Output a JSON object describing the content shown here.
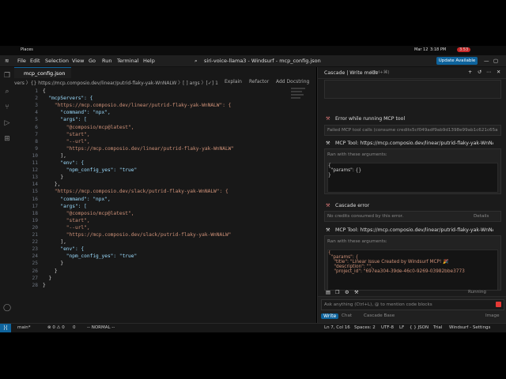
{
  "os": {
    "places": "Places",
    "date": "Mar 12",
    "time": "3:18 PM",
    "battery_badge": "3.53"
  },
  "menu": {
    "items": [
      "File",
      "Edit",
      "Selection",
      "View",
      "Go",
      "Run",
      "Terminal",
      "Help"
    ],
    "search": "siri-voice-llama3 - Windsurf - mcp_config.json",
    "update": "Update Available"
  },
  "editor": {
    "tab": "mcp_config.json",
    "breadcrumb": "vers 〉{} https://mcp.composio.dev/linear/putrid-flaky-yak-WnNALW 〉[ ] args 〉[✓] 1",
    "codelens": [
      "Explain",
      "Refactor",
      "Add Docstring"
    ],
    "lines": [
      {
        "n": "1",
        "t": "{"
      },
      {
        "n": "2",
        "t": "  \"mcpServers\": {"
      },
      {
        "n": "3",
        "t": "    \"https://mcp.composio.dev/linear/putrid-flaky-yak-WnNALW\": {"
      },
      {
        "n": "4",
        "t": "      \"command\": \"npx\","
      },
      {
        "n": "5",
        "t": "      \"args\": ["
      },
      {
        "n": "6",
        "t": "        \"@composio/mcp@latest\","
      },
      {
        "n": "7",
        "t": "        \"start\","
      },
      {
        "n": "8",
        "t": "        \"--url\","
      },
      {
        "n": "9",
        "t": "        \"https://mcp.composio.dev/linear/putrid-flaky-yak-WnNALW\""
      },
      {
        "n": "10",
        "t": "      ],"
      },
      {
        "n": "11",
        "t": "      \"env\": {"
      },
      {
        "n": "12",
        "t": "        \"npm_config_yes\": \"true\""
      },
      {
        "n": "13",
        "t": "      }"
      },
      {
        "n": "14",
        "t": "    },"
      },
      {
        "n": "15",
        "t": "    \"https://mcp.composio.dev/slack/putrid-flaky-yak-WnNALW\": {"
      },
      {
        "n": "16",
        "t": "      \"command\": \"npx\","
      },
      {
        "n": "17",
        "t": "      \"args\": ["
      },
      {
        "n": "18",
        "t": "        \"@composio/mcp@latest\","
      },
      {
        "n": "19",
        "t": "        \"start\","
      },
      {
        "n": "20",
        "t": "        \"--url\","
      },
      {
        "n": "21",
        "t": "        \"https://mcp.composio.dev/slack/putrid-flaky-yak-WnNALW\""
      },
      {
        "n": "22",
        "t": "      ],"
      },
      {
        "n": "23",
        "t": "      \"env\": {"
      },
      {
        "n": "24",
        "t": "        \"npm_config_yes\": \"true\""
      },
      {
        "n": "25",
        "t": "      }"
      },
      {
        "n": "26",
        "t": "    }"
      },
      {
        "n": "27",
        "t": "  }"
      },
      {
        "n": "28",
        "t": "}"
      }
    ]
  },
  "cascade": {
    "title": "Cascade | Write mode",
    "shortcut": "(Ctrl+⌘)",
    "error_title": "Error while running MCP tool",
    "error_sub": "Failed MCP tool calls (consume credits.",
    "error_id": "5cf049adf9ab9d1398e99ab1c621c65a",
    "tool1_title": "MCP Tool: https://mcp.composio.dev/linear/putrid-flaky-yak-WnNALW",
    "ran_args": "Ran with these arguments:",
    "tool1_json": "{\n  \"params\": {}\n}",
    "cascade_error": "Cascade error",
    "no_credits": "No credits consumed by this error.",
    "details": "Details",
    "tool2_title": "MCP Tool: https://mcp.composio.dev/linear/putrid-flaky-yak-WnNALW",
    "tool2_json": "{\n  \"params\": {\n    \"title\": \"Linear Issue Created by Windsurf MCP! 🎉\n    \"description\": \"\",\n    \"project_id\": \"697ea304-39de-46c0-9269-03982bbe3773",
    "running": "Running",
    "placeholder": "Ask anything (Ctrl+L), @ to mention code blocks",
    "write": "Write",
    "chat": "Chat",
    "cascade_base": "Cascade Base",
    "image": "Image"
  },
  "status": {
    "branch": "main*",
    "problems": "⊗ 0 ⚠ 0",
    "ports": "0",
    "mode": "-- NORMAL --",
    "pos": "Ln 7, Col 16",
    "spaces": "Spaces: 2",
    "enc": "UTF-8",
    "eol": "LF",
    "lang": "{ } JSON",
    "trial": "Trial",
    "settings": "Windsurf - Settings"
  }
}
